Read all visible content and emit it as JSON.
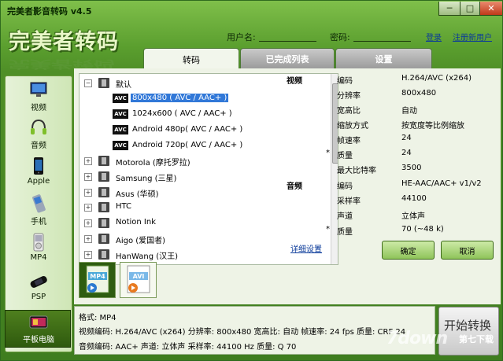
{
  "window": {
    "title": "完美者影音转码 v4.5",
    "controls": {
      "minimize": "─",
      "maximize": "□",
      "close": "✕"
    }
  },
  "logo": {
    "text": "完美者转码"
  },
  "login": {
    "username_label": "用户名:",
    "password_label": "密码:",
    "login_link": "登录",
    "register_link": "注册新用户"
  },
  "tabs": [
    {
      "label": "转码",
      "active": true
    },
    {
      "label": "已完成列表",
      "active": false
    },
    {
      "label": "设置",
      "active": false
    }
  ],
  "sidebar": {
    "items": [
      {
        "label": "视频",
        "icon": "monitor-icon"
      },
      {
        "label": "音频",
        "icon": "headphones-icon"
      },
      {
        "label": "Apple",
        "icon": "iphone-icon"
      },
      {
        "label": "手机",
        "icon": "phone-icon"
      },
      {
        "label": "MP4",
        "icon": "mp4-player-icon"
      },
      {
        "label": "PSP",
        "icon": "psp-icon"
      },
      {
        "label": "平板电脑",
        "icon": "tablet-icon",
        "active": true
      }
    ]
  },
  "tree": {
    "root": "默认",
    "presets": [
      {
        "text": "800x480 ( AVC / AAC+ )",
        "selected": true
      },
      {
        "text": "1024x600 ( AVC / AAC+ )"
      },
      {
        "text": "Android 480p( AVC / AAC+ )"
      },
      {
        "text": "Android 720p( AVC / AAC+ )"
      }
    ],
    "brands": [
      "Motorola (摩托罗拉)",
      "Samsung (三星)",
      "Asus (华硕)",
      "HTC",
      "Notion Ink",
      "Aigo (爱国者)",
      "HanWang (汉王)"
    ],
    "avc_badge": "AVC"
  },
  "formats": [
    {
      "label": "MP4",
      "selected": true
    },
    {
      "label": "AVI",
      "selected": false
    }
  ],
  "properties": {
    "video_section": "视频",
    "audio_section": "音频",
    "video": [
      {
        "key": "编码",
        "value": "H.264/AVC (x264)",
        "star": ""
      },
      {
        "key": "分辨率",
        "value": "800x480",
        "star": ""
      },
      {
        "key": "宽高比",
        "value": "自动",
        "star": ""
      },
      {
        "key": "缩放方式",
        "value": "按宽度等比例缩放",
        "star": ""
      },
      {
        "key": "帧速率",
        "value": "24",
        "star": ""
      },
      {
        "key": "质量",
        "value": "24",
        "star": "*"
      },
      {
        "key": "最大比特率",
        "value": "3500",
        "star": ""
      }
    ],
    "audio": [
      {
        "key": "编码",
        "value": "HE-AAC/AAC+ v1/v2",
        "star": ""
      },
      {
        "key": "采样率",
        "value": "44100",
        "star": ""
      },
      {
        "key": "声道",
        "value": "立体声",
        "star": ""
      },
      {
        "key": "质量",
        "value": "70 (~48 k)",
        "star": "*"
      }
    ],
    "advanced_link": "详细设置",
    "ok_button": "确定",
    "cancel_button": "取消"
  },
  "status": {
    "line1": "格式: MP4",
    "line2": "视频编码: H.264/AVC (x264)   分辨率: 800x480   宽高比: 自动   帧速率: 24 fps   质量: CRF 24",
    "line3": "音频编码: AAC+   声道: 立体声   采样率: 44100 Hz   质量: Q 70"
  },
  "start_button": "开始转换",
  "watermark": {
    "text": "7down",
    "sub": "第七下载"
  },
  "colors": {
    "accent": "#4f8f27",
    "selection": "#3178d8",
    "link": "#0a3a9a"
  }
}
